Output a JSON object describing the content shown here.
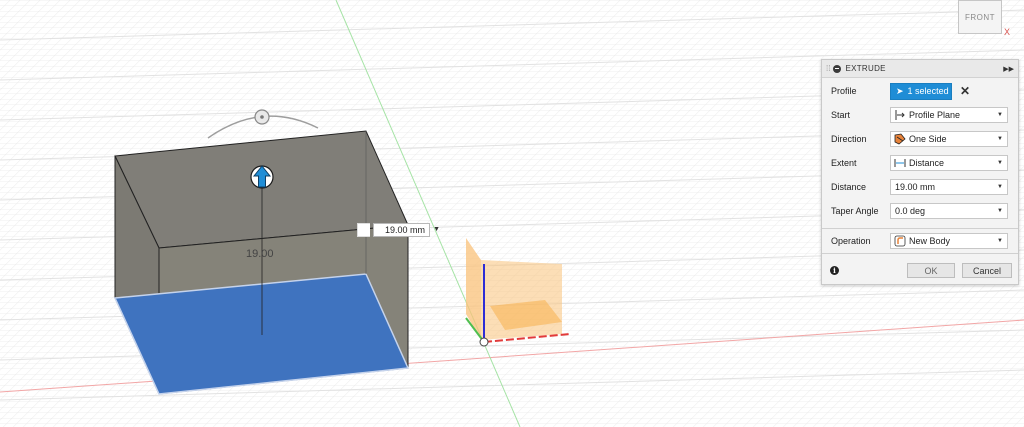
{
  "viewport": {
    "dimension_text": "19.00",
    "distance_input_value": "19.00 mm"
  },
  "viewcube": {
    "face_label": "FRONT",
    "axis_label": "X"
  },
  "panel": {
    "title": "EXTRUDE",
    "rows": {
      "profile": {
        "label": "Profile",
        "value": "1 selected"
      },
      "start": {
        "label": "Start",
        "value": "Profile Plane"
      },
      "direction": {
        "label": "Direction",
        "value": "One Side"
      },
      "extent": {
        "label": "Extent",
        "value": "Distance"
      },
      "distance": {
        "label": "Distance",
        "value": "19.00 mm"
      },
      "taper": {
        "label": "Taper Angle",
        "value": "0.0 deg"
      },
      "operation": {
        "label": "Operation",
        "value": "New Body"
      }
    },
    "ok_label": "OK",
    "cancel_label": "Cancel"
  },
  "colors": {
    "accent": "#1f8dd6",
    "body_gray": "#807e78",
    "profile_blue": "#3f73bf",
    "plane_orange": "#f9c27a",
    "x_axis": "#e23a3a",
    "y_axis": "#4fbf4f",
    "z_axis": "#2d2dd6"
  }
}
